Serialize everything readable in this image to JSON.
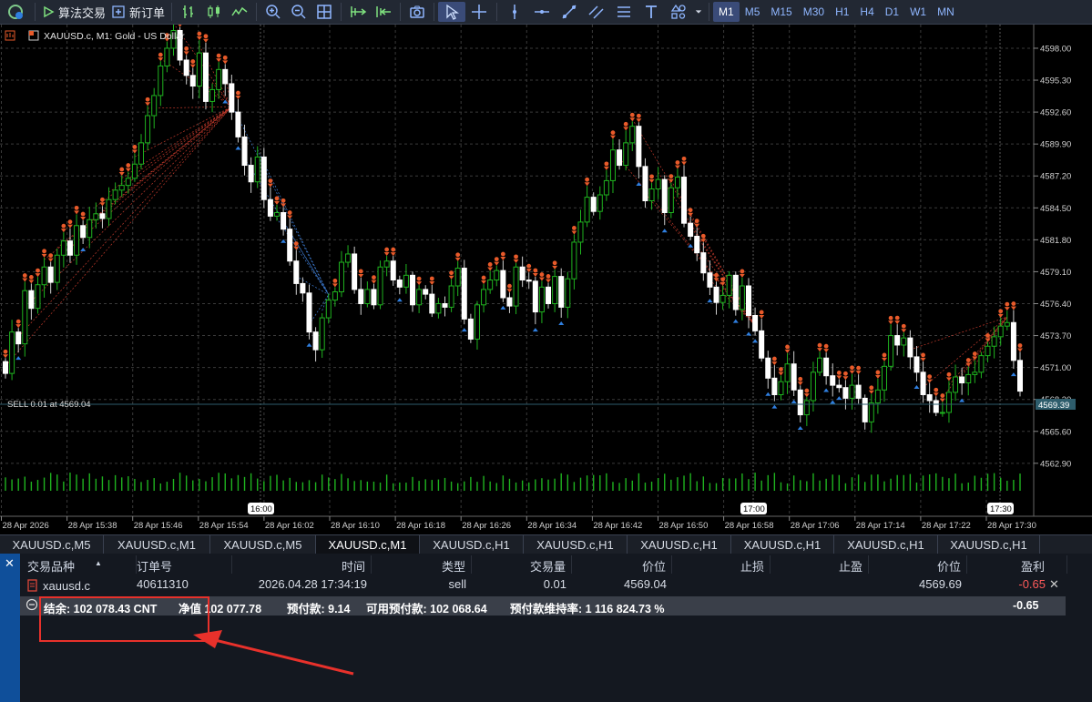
{
  "toolbar": {
    "algo_label": "算法交易",
    "new_order_label": "新订单",
    "timeframes": [
      "M1",
      "M5",
      "M15",
      "M30",
      "H1",
      "H4",
      "D1",
      "W1",
      "MN"
    ],
    "active_timeframe": "M1"
  },
  "chart": {
    "title": "XAUUSD.c, M1:  Gold - US Dollar",
    "order_line_label": "SELL 0.01 at 4569.04",
    "current_price_label": "4569.39",
    "price_ticks": [
      "4598.00",
      "4595.30",
      "4592.60",
      "4589.90",
      "4587.20",
      "4584.50",
      "4581.80",
      "4579.10",
      "4576.40",
      "4573.70",
      "4571.00",
      "4568.30",
      "4565.60",
      "4562.90"
    ],
    "time_ticks": [
      "28 Apr 2026",
      "28 Apr 15:38",
      "28 Apr 15:46",
      "28 Apr 15:54",
      "28 Apr 16:02",
      "28 Apr 16:10",
      "28 Apr 16:18",
      "28 Apr 16:26",
      "28 Apr 16:34",
      "28 Apr 16:42",
      "28 Apr 16:50",
      "28 Apr 16:58",
      "28 Apr 17:06",
      "28 Apr 17:14",
      "28 Apr 17:22",
      "28 Apr 17:30"
    ],
    "session_marks": [
      "16:00",
      "17:00",
      "17:30"
    ],
    "colors": {
      "bull": "#1fb31f",
      "bear": "#ffffff",
      "sell_marker": "#e85a2a",
      "buy_marker": "#2f7fe0",
      "grid": "#3a3a3a"
    }
  },
  "chart_data": {
    "type": "candlestick",
    "symbol": "XAUUSD.c",
    "timeframe": "M1",
    "ylim": [
      4561.5,
      4600.0
    ],
    "x_range": [
      "28 Apr 2026 15:29",
      "28 Apr 2026 17:32"
    ],
    "close": [
      4570.5,
      4574.0,
      4573.0,
      4577.5,
      4576.0,
      4578.0,
      4579.5,
      4578.2,
      4580.5,
      4581.7,
      4580.5,
      4583.0,
      4582.0,
      4583.5,
      4584.0,
      4583.6,
      4585.2,
      4586.0,
      4586.4,
      4587.0,
      4588.2,
      4590.0,
      4592.3,
      4594.0,
      4596.5,
      4598.0,
      4599.5,
      4597.0,
      4595.7,
      4594.8,
      4597.6,
      4593.5,
      4594.5,
      4596.2,
      4595.0,
      4592.6,
      4590.5,
      4588.1,
      4586.7,
      4588.8,
      4585.2,
      4583.8,
      4584.1,
      4582.7,
      4580.0,
      4578.1,
      4577.3,
      4574.0,
      4572.5,
      4575.2,
      4576.7,
      4577.4,
      4579.9,
      4580.6,
      4577.6,
      4576.4,
      4577.6,
      4576.3,
      4579.5,
      4580.0,
      4578.4,
      4577.8,
      4578.8,
      4576.3,
      4577.6,
      4577.2,
      4575.6,
      4576.4,
      4576.1,
      4577.9,
      4579.4,
      4575.1,
      4573.4,
      4576.3,
      4577.6,
      4578.4,
      4579.2,
      4576.9,
      4576.2,
      4579.5,
      4578.4,
      4578.3,
      4575.7,
      4577.8,
      4576.4,
      4578.7,
      4576.1,
      4578.5,
      4581.6,
      4583.3,
      4585.4,
      4584.2,
      4585.6,
      4586.8,
      4589.4,
      4588.1,
      4590.0,
      4591.4,
      4588.0,
      4585.1,
      4586.1,
      4586.9,
      4584.1,
      4586.2,
      4587.1,
      4583.2,
      4582.1,
      4580.7,
      4579.0,
      4577.8,
      4576.5,
      4577.1,
      4578.8,
      4575.9,
      4577.9,
      4575.4,
      4574.1,
      4571.8,
      4570.1,
      4568.7,
      4569.8,
      4571.3,
      4569.1,
      4567.0,
      4568.2,
      4570.6,
      4571.8,
      4570.3,
      4569.5,
      4569.3,
      4568.4,
      4569.5,
      4568.4,
      4566.4,
      4568.0,
      4569.1,
      4571.1,
      4573.7,
      4572.9,
      4573.5,
      4571.9,
      4570.6,
      4568.7,
      4568.2,
      4567.2,
      4567.2,
      4568.9,
      4570.2,
      4569.7,
      4570.4,
      4570.6,
      4572.0,
      4572.8,
      4573.6,
      4574.5,
      4574.8,
      4571.6,
      4569.0
    ]
  },
  "tabs": [
    "XAUUSD.c,M5",
    "XAUUSD.c,M1",
    "XAUUSD.c,M5",
    "XAUUSD.c,M1",
    "XAUUSD.c,H1",
    "XAUUSD.c,H1",
    "XAUUSD.c,H1",
    "XAUUSD.c,H1",
    "XAUUSD.c,H1",
    "XAUUSD.c,H1"
  ],
  "active_tab": 3,
  "trade": {
    "headers": [
      "交易品种",
      "订单号",
      "时间",
      "类型",
      "交易量",
      "价位",
      "止损",
      "止盈",
      "价位",
      "盈利"
    ],
    "row": {
      "symbol": "xauusd.c",
      "ticket": "40611310",
      "time": "2026.04.28 17:34:19",
      "type": "sell",
      "volume": "0.01",
      "open_price": "4569.04",
      "sl": "",
      "tp": "",
      "current_price": "4569.69",
      "profit": "-0.65"
    },
    "summary": {
      "balance": "结余: 102 078.43 CNT",
      "equity": "净值 102 077.78",
      "margin": "预付款: 9.14",
      "free_margin": "可用预付款: 102 068.64",
      "margin_level": "预付款维持率: 1 116 824.73 %",
      "total_profit": "-0.65"
    }
  }
}
